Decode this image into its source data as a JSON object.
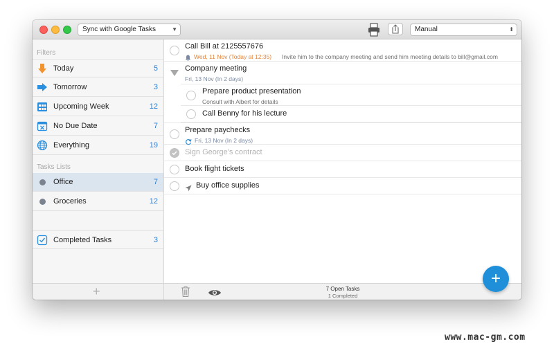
{
  "toolbar": {
    "sync_select": "Sync with Google Tasks",
    "sort_select": "Manual"
  },
  "sidebar": {
    "filters_label": "Filters",
    "filters": [
      {
        "label": "Today",
        "count": "5",
        "icon": "arrow-down-icon"
      },
      {
        "label": "Tomorrow",
        "count": "3",
        "icon": "arrow-right-icon"
      },
      {
        "label": "Upcoming Week",
        "count": "12",
        "icon": "calendar-week-icon"
      },
      {
        "label": "No Due Date",
        "count": "7",
        "icon": "calendar-x-icon"
      },
      {
        "label": "Everything",
        "count": "19",
        "icon": "globe-icon"
      }
    ],
    "lists_label": "Tasks Lists",
    "lists": [
      {
        "label": "Office",
        "count": "7",
        "selected": true
      },
      {
        "label": "Groceries",
        "count": "12",
        "selected": false
      }
    ],
    "completed": {
      "label": "Completed Tasks",
      "count": "3"
    }
  },
  "tasks": [
    {
      "title": "Call Bill at 2125557676",
      "date": "Wed, 11 Nov (Today at 12:35)",
      "note": "Invite him to the company meeting and send him meeting details to bill@gmail.com"
    },
    {
      "title": "Company meeting",
      "date": "Fri, 13 Nov (In 2 days)"
    },
    {
      "title": "Prepare product presentation",
      "note": "Consult with Albert for details"
    },
    {
      "title": "Call Benny for his lecture"
    },
    {
      "title": "Prepare paychecks",
      "date": "Fri, 13 Nov (In 2 days)"
    },
    {
      "title": "Sign George's contract",
      "completed": true
    },
    {
      "title": "Book flight tickets"
    },
    {
      "title": "Buy office supplies"
    }
  ],
  "footer": {
    "open_tasks": "7 Open Tasks",
    "completed": "1 Completed"
  },
  "colors": {
    "accent": "#2a7fd4",
    "fab": "#1e8fd8",
    "alert": "#e2833a",
    "selected_row": "#dbe5ef"
  },
  "watermark": "www.mac-gm.com"
}
